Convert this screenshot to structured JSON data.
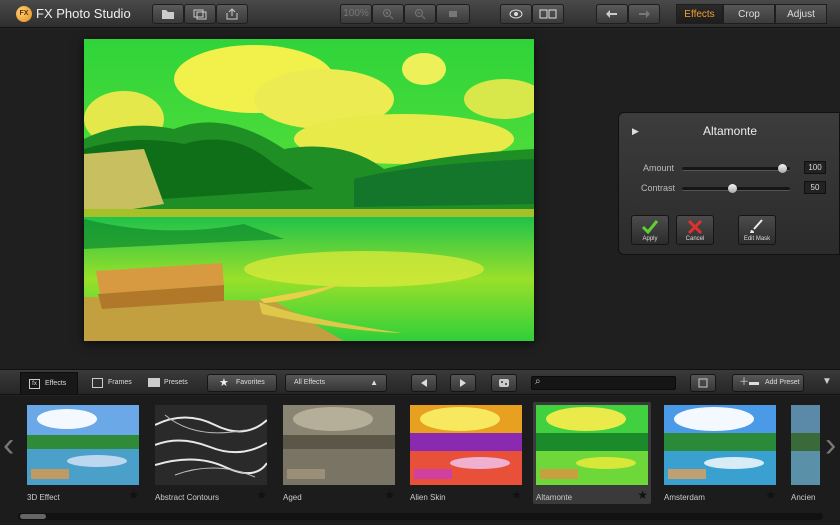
{
  "app": {
    "title": "FX Photo Studio",
    "logo_text": "FX"
  },
  "toolbar": {
    "zoom": "100%",
    "tabs": [
      "Effects",
      "Crop",
      "Adjust"
    ],
    "active_tab": "Effects",
    "accent": "#f0a030"
  },
  "panel": {
    "title": "Altamonte",
    "sliders": [
      {
        "label": "Amount",
        "value": "100",
        "fraction": 1.0
      },
      {
        "label": "Contrast",
        "value": "50",
        "fraction": 0.5
      }
    ],
    "buttons": {
      "apply": "Apply",
      "cancel": "Cancel",
      "edit_mask": "Edit Mask"
    }
  },
  "bottombar": {
    "tabs": [
      "Effects",
      "Frames",
      "Presets"
    ],
    "favorites": "Favorites",
    "filter": "All Effects",
    "add_preset": "Add Preset"
  },
  "effects": [
    {
      "name": "3D Effect"
    },
    {
      "name": "Abstract Contours"
    },
    {
      "name": "Aged"
    },
    {
      "name": "Alien Skin"
    },
    {
      "name": "Altamonte",
      "selected": true
    },
    {
      "name": "Amsterdam"
    },
    {
      "name": "Ancien"
    }
  ]
}
